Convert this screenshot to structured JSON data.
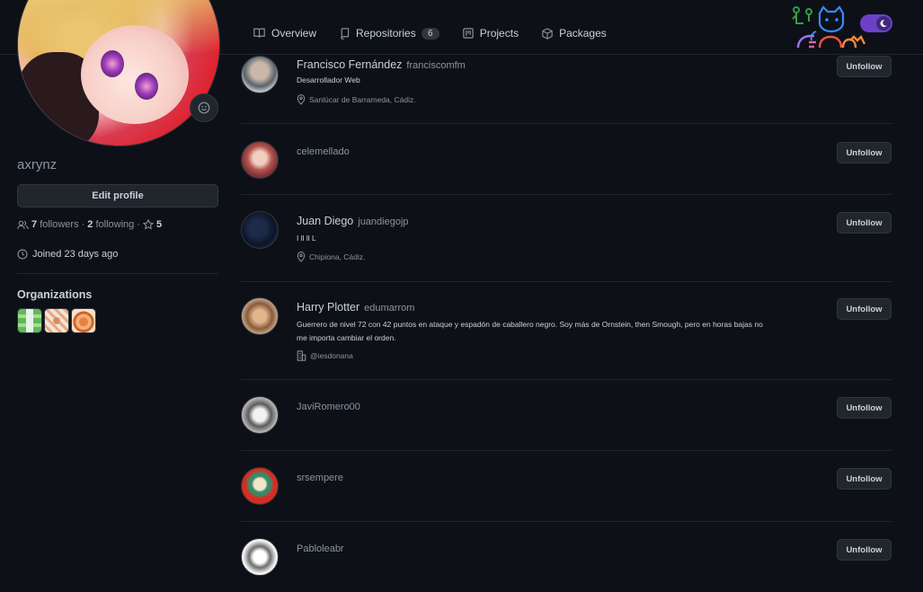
{
  "nav": {
    "tabs": [
      {
        "label": "Overview",
        "icon": "book-icon"
      },
      {
        "label": "Repositories",
        "icon": "repo-icon",
        "count": "6"
      },
      {
        "label": "Projects",
        "icon": "project-icon"
      },
      {
        "label": "Packages",
        "icon": "package-icon"
      }
    ],
    "theme_toggle": "moon-icon"
  },
  "profile": {
    "username": "axrynz",
    "edit_label": "Edit profile",
    "followers_count": "7",
    "followers_label": "followers",
    "following_count": "2",
    "following_label": "following",
    "stars_count": "5",
    "joined": "Joined 23 days ago",
    "organizations_title": "Organizations"
  },
  "following": [
    {
      "name": "Francisco Fernández",
      "login": "franciscomfm",
      "bio": "Desarrollador Web",
      "location": "Sanlúcar de Barrameda, Cádiz.",
      "button": "Unfollow"
    },
    {
      "name": "",
      "login": "celemellado",
      "button": "Unfollow"
    },
    {
      "name": "Juan Diego",
      "login": "juandiegojp",
      "bio": "I ll ll L",
      "location": "Chipiona, Cádiz.",
      "button": "Unfollow"
    },
    {
      "name": "Harry Plotter",
      "login": "edumarrom",
      "bio": "Guerrero de nivel 72 con 42 puntos en ataque y espadón de caballero negro. Soy más de Ornstein, then Smough, pero en horas bajas no me importa cambiar el orden.",
      "company": "@iesdonana",
      "button": "Unfollow"
    },
    {
      "name": "",
      "login": "JaviRomero00",
      "button": "Unfollow"
    },
    {
      "name": "",
      "login": "srsempere",
      "button": "Unfollow"
    },
    {
      "name": "",
      "login": "Pabloleabr",
      "button": "Unfollow"
    }
  ],
  "colors": {
    "background": "#0d1117",
    "accent": "#6e40c9",
    "border": "#30363d"
  }
}
